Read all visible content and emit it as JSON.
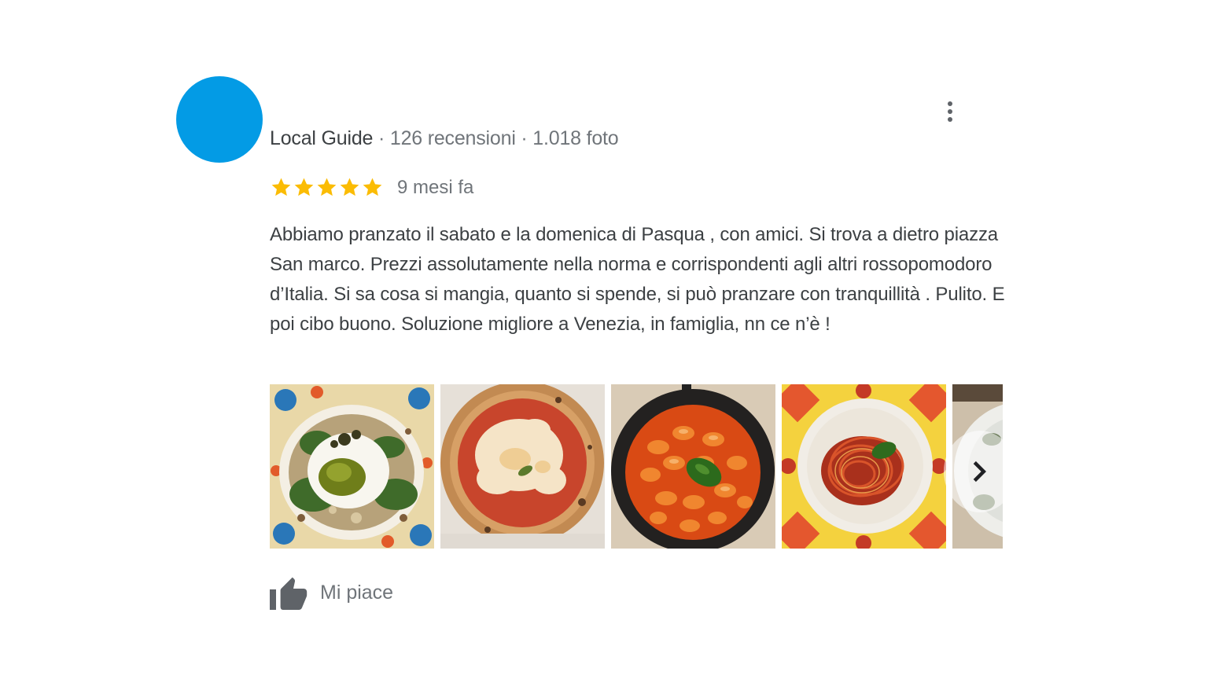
{
  "reviewer": {
    "avatar_color": "#039be5",
    "badge": "Local Guide",
    "separator": " · ",
    "reviews_count": "126 recensioni",
    "photos_count": "1.018 foto"
  },
  "menu": {
    "icon": "more-vert-icon"
  },
  "rating": {
    "stars": 5,
    "max_stars": 5,
    "star_color": "#fbbc04",
    "date": "9 mesi fa"
  },
  "review_text": "Abbiamo pranzato il sabato e la domenica di Pasqua , con amici. Si trova a dietro piazza San marco. Prezzi assolutamente nella norma e corrispondenti agli altri rossopomodoro d’Italia. Si sa cosa si mangia, quanto si spende, si può pranzare con tranquillità . Pulito. E poi cibo buono. Soluzione migliore a Venezia, in famiglia, nn ce n’è !",
  "photos": [
    {
      "subject": "burrata with pesto and salad"
    },
    {
      "subject": "margherita pizza"
    },
    {
      "subject": "gnocchi with tomato sauce in pan"
    },
    {
      "subject": "spaghetti al pomodoro with basil"
    },
    {
      "subject": "partially visible plate"
    }
  ],
  "carousel": {
    "next_icon": "chevron-right-icon"
  },
  "actions": {
    "like_label": "Mi piace",
    "like_icon": "thumb-up-icon"
  }
}
